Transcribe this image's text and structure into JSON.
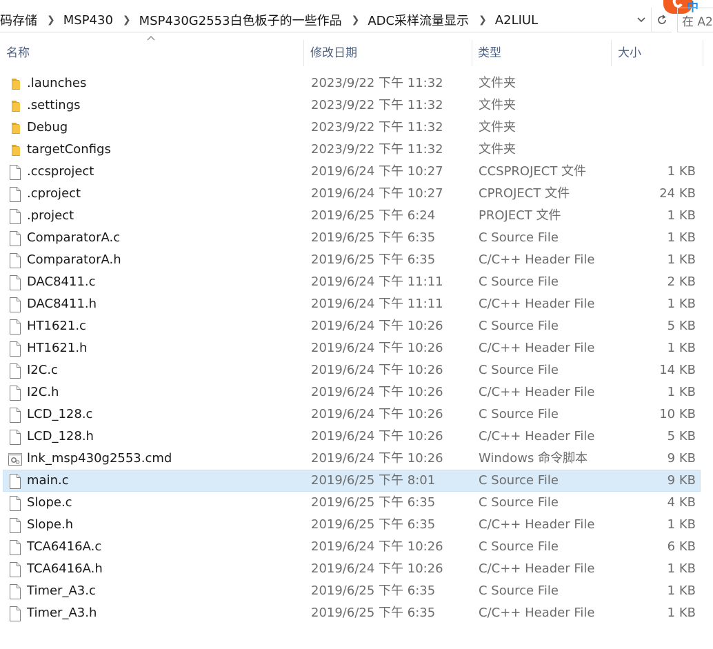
{
  "address_bar": {
    "crumbs": [
      "码存储",
      "MSP430",
      "MSP430G2553白色板子的一些作品",
      "ADC采样流量显示",
      "A2LIUL"
    ]
  },
  "search": {
    "placeholder": "在 A2"
  },
  "columns": {
    "name": "名称",
    "date": "修改日期",
    "type": "类型",
    "size": "大小"
  },
  "files": [
    {
      "name": ".launches",
      "date": "2023/9/22 下午 11:32",
      "type": "文件夹",
      "size": "",
      "icon": "folder-icon"
    },
    {
      "name": ".settings",
      "date": "2023/9/22 下午 11:32",
      "type": "文件夹",
      "size": "",
      "icon": "folder-icon"
    },
    {
      "name": "Debug",
      "date": "2023/9/22 下午 11:32",
      "type": "文件夹",
      "size": "",
      "icon": "folder-icon"
    },
    {
      "name": "targetConfigs",
      "date": "2023/9/22 下午 11:32",
      "type": "文件夹",
      "size": "",
      "icon": "folder-icon"
    },
    {
      "name": ".ccsproject",
      "date": "2019/6/24 下午 10:27",
      "type": "CCSPROJECT 文件",
      "size": "1 KB",
      "icon": "file-icon"
    },
    {
      "name": ".cproject",
      "date": "2019/6/24 下午 10:27",
      "type": "CPROJECT 文件",
      "size": "24 KB",
      "icon": "file-icon"
    },
    {
      "name": ".project",
      "date": "2019/6/25 下午 6:24",
      "type": "PROJECT 文件",
      "size": "1 KB",
      "icon": "file-icon"
    },
    {
      "name": "ComparatorA.c",
      "date": "2019/6/25 下午 6:35",
      "type": "C Source File",
      "size": "1 KB",
      "icon": "file-icon"
    },
    {
      "name": "ComparatorA.h",
      "date": "2019/6/25 下午 6:35",
      "type": "C/C++ Header File",
      "size": "1 KB",
      "icon": "file-icon"
    },
    {
      "name": "DAC8411.c",
      "date": "2019/6/24 下午 11:11",
      "type": "C Source File",
      "size": "2 KB",
      "icon": "file-icon"
    },
    {
      "name": "DAC8411.h",
      "date": "2019/6/24 下午 11:11",
      "type": "C/C++ Header File",
      "size": "1 KB",
      "icon": "file-icon"
    },
    {
      "name": "HT1621.c",
      "date": "2019/6/24 下午 10:26",
      "type": "C Source File",
      "size": "5 KB",
      "icon": "file-icon"
    },
    {
      "name": "HT1621.h",
      "date": "2019/6/24 下午 10:26",
      "type": "C/C++ Header File",
      "size": "1 KB",
      "icon": "file-icon"
    },
    {
      "name": "I2C.c",
      "date": "2019/6/24 下午 10:26",
      "type": "C Source File",
      "size": "14 KB",
      "icon": "file-icon"
    },
    {
      "name": "I2C.h",
      "date": "2019/6/24 下午 10:26",
      "type": "C/C++ Header File",
      "size": "1 KB",
      "icon": "file-icon"
    },
    {
      "name": "LCD_128.c",
      "date": "2019/6/24 下午 10:26",
      "type": "C Source File",
      "size": "10 KB",
      "icon": "file-icon"
    },
    {
      "name": "LCD_128.h",
      "date": "2019/6/24 下午 10:26",
      "type": "C/C++ Header File",
      "size": "5 KB",
      "icon": "file-icon"
    },
    {
      "name": "lnk_msp430g2553.cmd",
      "date": "2019/6/24 下午 10:26",
      "type": "Windows 命令脚本",
      "size": "9 KB",
      "icon": "script-icon"
    },
    {
      "name": "main.c",
      "date": "2019/6/25 下午 8:01",
      "type": "C Source File",
      "size": "9 KB",
      "icon": "file-icon",
      "selected": true
    },
    {
      "name": "Slope.c",
      "date": "2019/6/25 下午 6:35",
      "type": "C Source File",
      "size": "4 KB",
      "icon": "file-icon"
    },
    {
      "name": "Slope.h",
      "date": "2019/6/25 下午 6:35",
      "type": "C/C++ Header File",
      "size": "1 KB",
      "icon": "file-icon"
    },
    {
      "name": "TCA6416A.c",
      "date": "2019/6/24 下午 10:26",
      "type": "C Source File",
      "size": "6 KB",
      "icon": "file-icon"
    },
    {
      "name": "TCA6416A.h",
      "date": "2019/6/24 下午 10:26",
      "type": "C/C++ Header File",
      "size": "1 KB",
      "icon": "file-icon"
    },
    {
      "name": "Timer_A3.c",
      "date": "2019/6/25 下午 6:35",
      "type": "C Source File",
      "size": "1 KB",
      "icon": "file-icon"
    },
    {
      "name": "Timer_A3.h",
      "date": "2019/6/25 下午 6:35",
      "type": "C/C++ Header File",
      "size": "1 KB",
      "icon": "file-icon"
    }
  ],
  "colors": {
    "selected_row": "#d9ebf9",
    "folder": "#f2c94c",
    "header_text": "#4d6082",
    "ime_brand": "#f25c1f"
  }
}
